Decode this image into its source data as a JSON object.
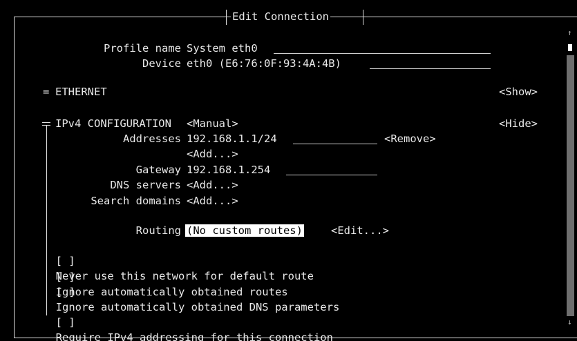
{
  "window": {
    "title": "Edit Connection"
  },
  "profile": {
    "name_label": "Profile name",
    "name_value": "System eth0",
    "device_label": "Device",
    "device_value": "eth0 (E6:76:0F:93:4A:4B)"
  },
  "ethernet": {
    "marker": "=",
    "label": "ETHERNET",
    "toggle": "<Show>"
  },
  "ipv4": {
    "marker": "╤",
    "label": "IPv4 CONFIGURATION",
    "mode": "<Manual>",
    "toggle": "<Hide>",
    "addresses_label": "Addresses",
    "address_value": "192.168.1.1/24",
    "remove_label": "<Remove>",
    "add_address_label": "<Add...>",
    "gateway_label": "Gateway",
    "gateway_value": "192.168.1.254",
    "dns_label": "DNS servers",
    "dns_add": "<Add...>",
    "search_label": "Search domains",
    "search_add": "<Add...>",
    "routing_label": "Routing",
    "routing_value": "(No custom routes)",
    "routing_edit": "<Edit...>",
    "checkboxes": [
      {
        "box": "[ ]",
        "label": "Never use this network for default route"
      },
      {
        "box": "[ ]",
        "label": "Ignore automatically obtained routes"
      },
      {
        "box": "[ ]",
        "label": "Ignore automatically obtained DNS parameters"
      },
      {
        "box": "[ ]",
        "label": "Require IPv4 addressing for this connection"
      }
    ]
  },
  "scrollbar": {
    "up_arrow": "↑",
    "down_arrow": "↓"
  }
}
